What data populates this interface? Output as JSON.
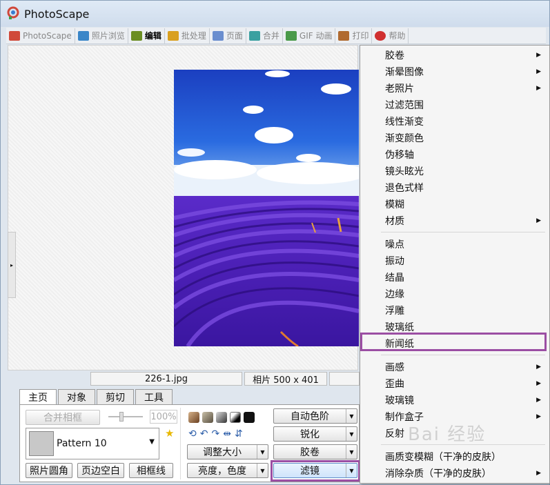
{
  "window": {
    "title": "PhotoScape"
  },
  "app_tabs": [
    {
      "label": "PhotoScape",
      "icon": "photoscape-icon",
      "active": false
    },
    {
      "label": "照片浏览",
      "icon": "viewer-icon",
      "active": false
    },
    {
      "label": "编辑",
      "icon": "editor-icon",
      "active": true
    },
    {
      "label": "批处理",
      "icon": "batch-icon",
      "active": false
    },
    {
      "label": "页面",
      "icon": "page-icon",
      "active": false
    },
    {
      "label": "合并",
      "icon": "combine-icon",
      "active": false
    },
    {
      "label": "GIF 动画",
      "icon": "gif-icon",
      "active": false
    },
    {
      "label": "打印",
      "icon": "print-icon",
      "active": false
    },
    {
      "label": "帮助",
      "icon": "help-icon",
      "active": false
    }
  ],
  "status": {
    "filename": "226-1.jpg",
    "size": "相片 500 x 401"
  },
  "panel": {
    "tabs": [
      "主页",
      "对象",
      "剪切",
      "工具"
    ],
    "merge_frame": "合并相框",
    "zoom": "100%",
    "pattern": "Pattern 10",
    "round_corner": "照片圆角",
    "margin": "页边空白",
    "frame_line": "相框线",
    "resize": "调整大小",
    "brightness": "亮度，色度",
    "auto_level": "自动色阶",
    "sharpen": "锐化",
    "film": "胶卷",
    "filter": "滤镜"
  },
  "filter_menu": {
    "items_group1": [
      {
        "label": "胶卷",
        "submenu": true
      },
      {
        "label": "渐晕图像",
        "submenu": true
      },
      {
        "label": "老照片",
        "submenu": true
      },
      {
        "label": "过滤范围",
        "submenu": false
      },
      {
        "label": "线性渐变",
        "submenu": false
      },
      {
        "label": "渐变颜色",
        "submenu": false
      },
      {
        "label": "伪移轴",
        "submenu": false
      },
      {
        "label": "镜头眩光",
        "submenu": false
      },
      {
        "label": "退色式样",
        "submenu": false
      },
      {
        "label": "模糊",
        "submenu": false
      },
      {
        "label": "材质",
        "submenu": true
      }
    ],
    "items_group2": [
      {
        "label": "噪点",
        "submenu": false
      },
      {
        "label": "振动",
        "submenu": false
      },
      {
        "label": "结晶",
        "submenu": false
      },
      {
        "label": "边缘",
        "submenu": false
      },
      {
        "label": "浮雕",
        "submenu": false
      },
      {
        "label": "玻璃纸",
        "submenu": false
      },
      {
        "label": "新闻纸",
        "submenu": false
      }
    ],
    "items_group3": [
      {
        "label": "画感",
        "submenu": true
      },
      {
        "label": "歪曲",
        "submenu": true
      },
      {
        "label": "玻璃镜",
        "submenu": true
      },
      {
        "label": "制作盒子",
        "submenu": true
      },
      {
        "label": "反射",
        "submenu": false
      }
    ],
    "items_group4": [
      {
        "label": "画质变模糊（干净的皮肤）",
        "submenu": false
      },
      {
        "label": "消除杂质（干净的皮肤）",
        "submenu": true
      }
    ]
  },
  "watermark": "Bai 经验",
  "colors": {
    "highlight": "#9b4ea3",
    "menu_bg": "#f5f5f5"
  }
}
